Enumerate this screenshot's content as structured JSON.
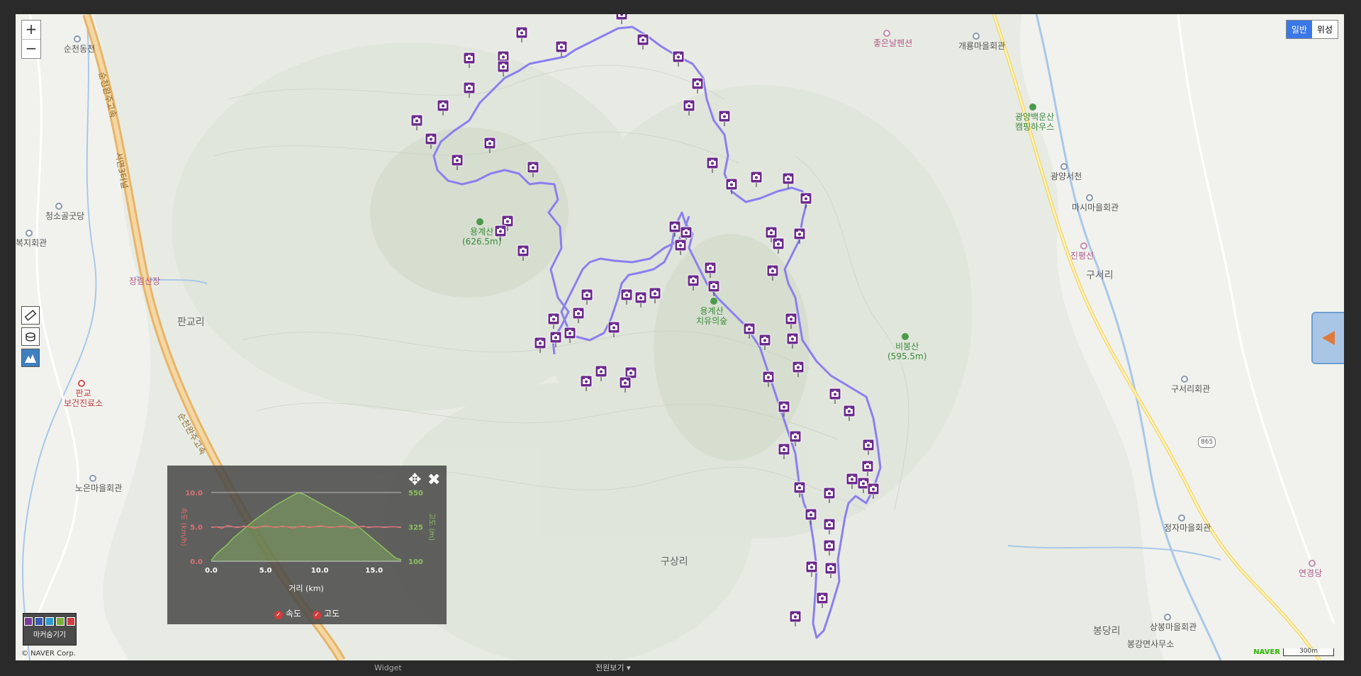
{
  "map_type": {
    "normal": "일반",
    "satellite": "위성"
  },
  "zoom": {
    "in": "+",
    "out": "−"
  },
  "places": [
    {
      "name": "순천동천",
      "kind": "plain"
    },
    {
      "name": "청소골굿당",
      "kind": "plain"
    },
    {
      "name": "복지회관",
      "kind": "plain"
    },
    {
      "name": "판교리",
      "kind": "big"
    },
    {
      "name": "판교\n보건진료소",
      "kind": "red"
    },
    {
      "name": "노은마을회관",
      "kind": "plain"
    },
    {
      "name": "용계산\n(626.5m)",
      "kind": "green"
    },
    {
      "name": "용계산\n치유의숲",
      "kind": "green"
    },
    {
      "name": "비봉산\n(595.5m)",
      "kind": "green"
    },
    {
      "name": "좋은날펜션",
      "kind": "pink"
    },
    {
      "name": "개룡마을회관",
      "kind": "plain"
    },
    {
      "name": "광양백운산\n캠핑하우스",
      "kind": "green"
    },
    {
      "name": "광양서천",
      "kind": "plain"
    },
    {
      "name": "마시마을회관",
      "kind": "plain"
    },
    {
      "name": "진평선",
      "kind": "pink"
    },
    {
      "name": "구서리",
      "kind": "big"
    },
    {
      "name": "구서리회관",
      "kind": "plain"
    },
    {
      "name": "정자마을회관",
      "kind": "plain"
    },
    {
      "name": "연경당",
      "kind": "pink"
    },
    {
      "name": "상봉마을회관",
      "kind": "plain"
    },
    {
      "name": "봉당리",
      "kind": "big"
    },
    {
      "name": "구상리",
      "kind": "big"
    },
    {
      "name": "순천완주고속",
      "kind": "plain"
    },
    {
      "name": "순천완주고속",
      "kind": "plain"
    },
    {
      "name": "서면3터널",
      "kind": "plain"
    },
    {
      "name": "봉강면사무소",
      "kind": "plain"
    },
    {
      "name": "장림산장",
      "kind": "pink"
    }
  ],
  "road_badge": "865",
  "icons": {
    "ruler": "ruler-icon",
    "area": "area-measure-icon",
    "elevation": "elevation-profile-icon",
    "move": "move-icon",
    "close": "close-icon",
    "sidetab": "triangle-left-icon",
    "camera": "camera-icon"
  },
  "colors": {
    "track": "#8a7ff0",
    "marker": "#6b2a8c",
    "speed": "#e07070",
    "altitude": "#8dc060"
  },
  "chart_data": {
    "type": "line",
    "x": [
      0,
      0.5,
      1,
      1.5,
      2,
      2.5,
      3,
      3.5,
      4,
      4.5,
      5,
      5.5,
      6,
      6.5,
      7,
      7.5,
      8,
      8.5,
      9,
      9.5,
      10,
      10.5,
      11,
      11.5,
      12,
      12.5,
      13,
      13.5,
      14,
      14.5,
      15,
      15.5,
      16,
      16.5,
      17,
      17.5
    ],
    "series": [
      {
        "name": "속도",
        "axis": "left",
        "values": [
          4.9,
          5.0,
          4.8,
          5.2,
          5.0,
          4.9,
          5.1,
          5.0,
          4.8,
          5.0,
          5.2,
          5.0,
          4.9,
          5.1,
          5.0,
          4.8,
          5.0,
          5.1,
          4.9,
          5.0,
          5.2,
          5.0,
          4.9,
          5.0,
          5.1,
          5.0,
          4.8,
          5.0,
          5.1,
          4.9,
          5.0,
          5.0,
          4.9,
          5.0,
          5.0,
          4.9
        ]
      },
      {
        "name": "고도",
        "axis": "right",
        "values": [
          105,
          150,
          180,
          210,
          250,
          280,
          310,
          340,
          370,
          395,
          420,
          445,
          470,
          490,
          510,
          530,
          548,
          540,
          520,
          500,
          480,
          460,
          440,
          420,
          400,
          380,
          355,
          330,
          300,
          270,
          240,
          210,
          180,
          150,
          120,
          110
        ]
      }
    ],
    "xlabel": "거리 (km)",
    "ylabel_left": "속도 (km/h)",
    "ylabel_right": "고도 (m)",
    "x_ticks": [
      "0.0",
      "5.0",
      "10.0",
      "15.0"
    ],
    "y_left_ticks": [
      "0.0",
      "5.0",
      "10.0"
    ],
    "y_right_ticks": [
      "100",
      "325",
      "550"
    ],
    "xlim": [
      0,
      17.5
    ],
    "ylim_left": [
      0,
      10
    ],
    "ylim_right": [
      100,
      550
    ]
  },
  "chart_legend": {
    "speed": "속도",
    "altitude": "고도"
  },
  "marker_button": "마커숨기기",
  "copyright": "© NAVER Corp.",
  "naver": "NAVER",
  "scale": "300m",
  "below_select": "전원보기 ▾",
  "below_left": "Widget"
}
